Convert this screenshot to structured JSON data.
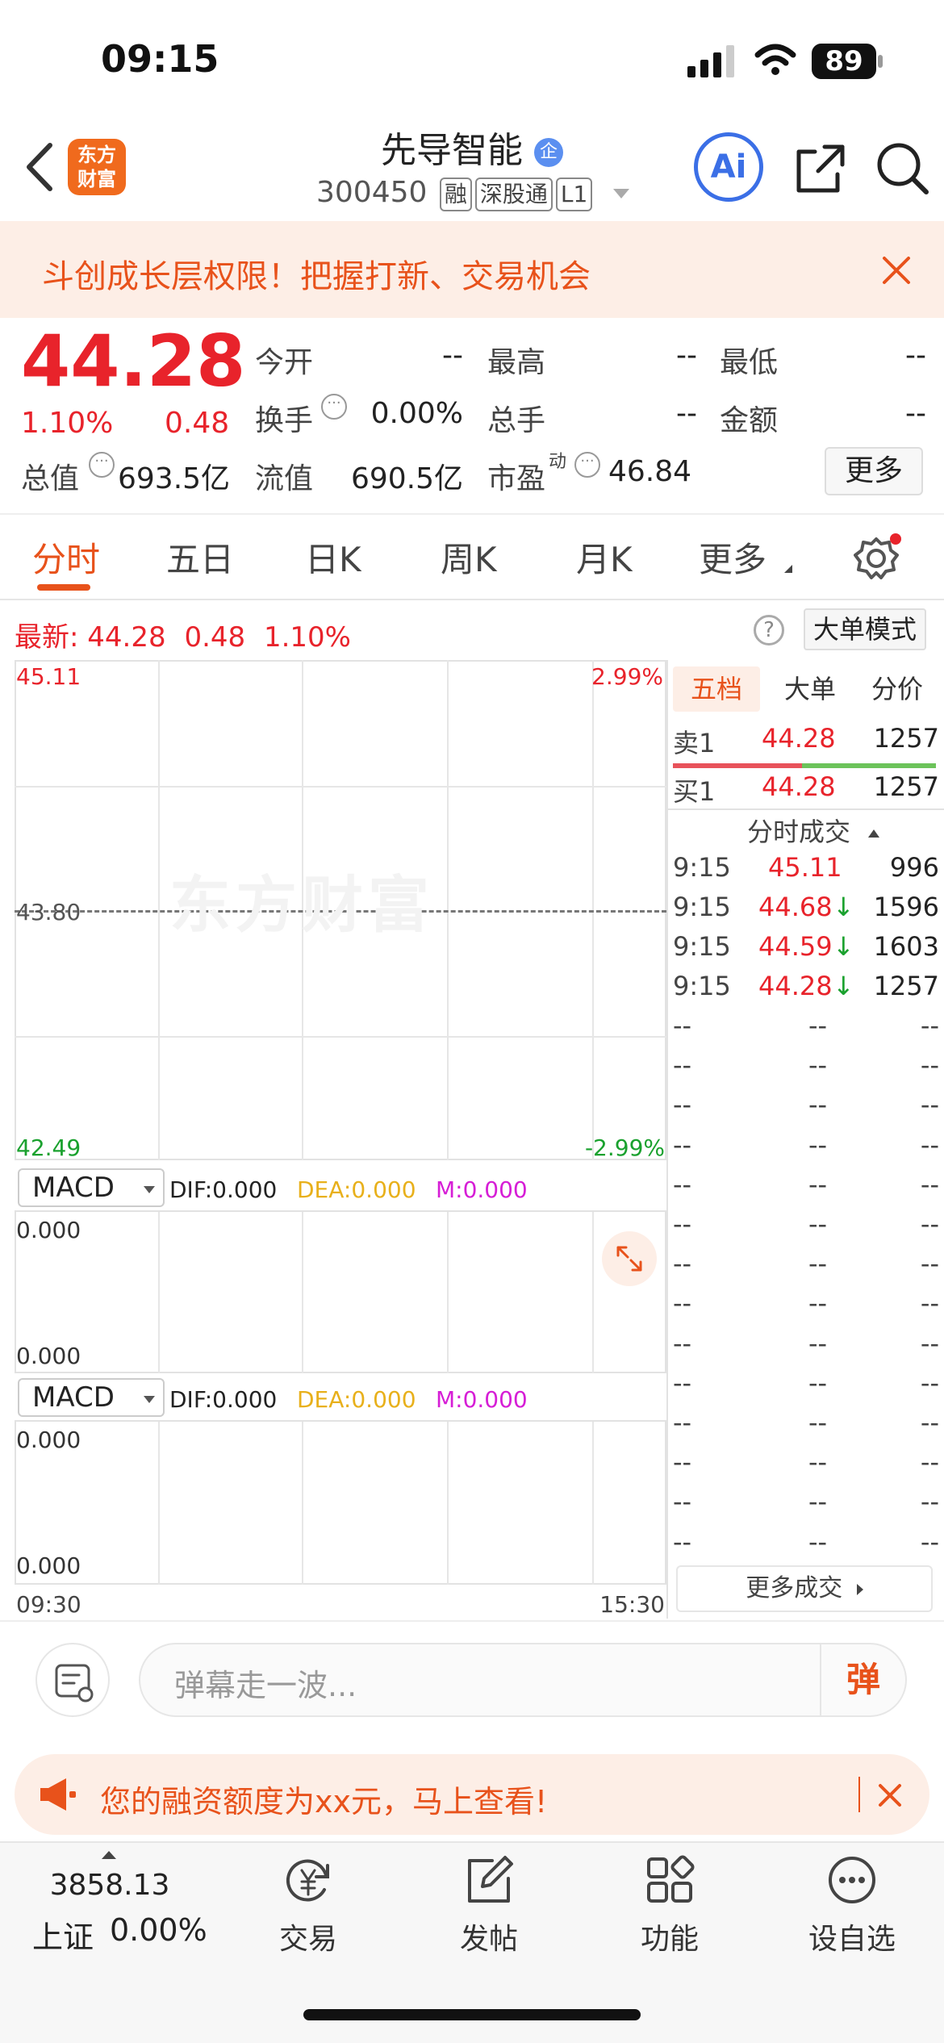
{
  "status": {
    "time": "09:15",
    "battery": "89"
  },
  "header": {
    "brand": "东方\n财富",
    "title": "先导智能",
    "corp_badge": "企",
    "code": "300450",
    "tags": [
      "融",
      "深股通",
      "L1"
    ],
    "ai_label": "Ai"
  },
  "banner": {
    "text": "斗创成长层权限！把握打新、交易机会"
  },
  "quote": {
    "price": "44.28",
    "pct": "1.10%",
    "chg": "0.48",
    "fields": [
      {
        "label": "今开",
        "value": "--"
      },
      {
        "label": "最高",
        "value": "--"
      },
      {
        "label": "最低",
        "value": "--"
      },
      {
        "label": "换手",
        "value": "0.00%"
      },
      {
        "label": "总手",
        "value": "--"
      },
      {
        "label": "金额",
        "value": "--"
      }
    ],
    "total_value_label": "总值",
    "total_value": "693.5亿",
    "float_label": "流值",
    "float_value": "690.5亿",
    "pe_label": "市盈",
    "pe_sup": "动",
    "pe_value": "46.84",
    "more_label": "更多"
  },
  "tabs": [
    "分时",
    "五日",
    "日K",
    "周K",
    "月K",
    "更多"
  ],
  "chart": {
    "latest_label": "最新:",
    "latest_price": "44.28",
    "latest_chg": "0.48",
    "latest_pct": "1.10%",
    "mode_label": "大单模式",
    "help": "?",
    "y_high": "45.11",
    "y_mid": "43.80",
    "y_low": "42.49",
    "pct_high": "2.99%",
    "pct_low": "-2.99%",
    "watermark": "东方财富",
    "t_start": "09:30",
    "t_end": "15:30",
    "indicator1": {
      "name": "MACD",
      "dif": "DIF:0.000",
      "dea": "DEA:0.000",
      "m": "M:0.000",
      "top": "0.000",
      "bottom": "0.000"
    },
    "indicator2": {
      "name": "MACD",
      "dif": "DIF:0.000",
      "dea": "DEA:0.000",
      "m": "M:0.000",
      "top": "0.000",
      "bottom": "0.000"
    },
    "colors": {
      "dea": "#e8b01b",
      "m": "#d61ed6"
    }
  },
  "orderbook": {
    "tabs": [
      "五档",
      "大单",
      "分价"
    ],
    "sell": {
      "label": "卖1",
      "price": "44.28",
      "vol": "1257"
    },
    "buy": {
      "label": "买1",
      "price": "44.28",
      "vol": "1257"
    },
    "ticks_title": "分时成交",
    "ticks": [
      {
        "t": "9:15",
        "p": "45.11",
        "v": "996",
        "dir": ""
      },
      {
        "t": "9:15",
        "p": "44.68",
        "v": "1596",
        "dir": "↓"
      },
      {
        "t": "9:15",
        "p": "44.59",
        "v": "1603",
        "dir": "↓"
      },
      {
        "t": "9:15",
        "p": "44.28",
        "v": "1257",
        "dir": "↓"
      }
    ],
    "empty": "--",
    "more_label": "更多成交"
  },
  "danmaku": {
    "placeholder": "弹幕走一波...",
    "send": "弹"
  },
  "promo": {
    "text": "您的融资额度为xx元，马上查看!"
  },
  "nav": {
    "index_value": "3858.13",
    "index_name": "上证",
    "index_pct": "0.00%",
    "items": [
      {
        "label": "交易",
        "icon": "yen-cycle-icon"
      },
      {
        "label": "发帖",
        "icon": "edit-icon"
      },
      {
        "label": "功能",
        "icon": "grid-icon"
      },
      {
        "label": "设自选",
        "icon": "more-circle-icon"
      }
    ]
  }
}
